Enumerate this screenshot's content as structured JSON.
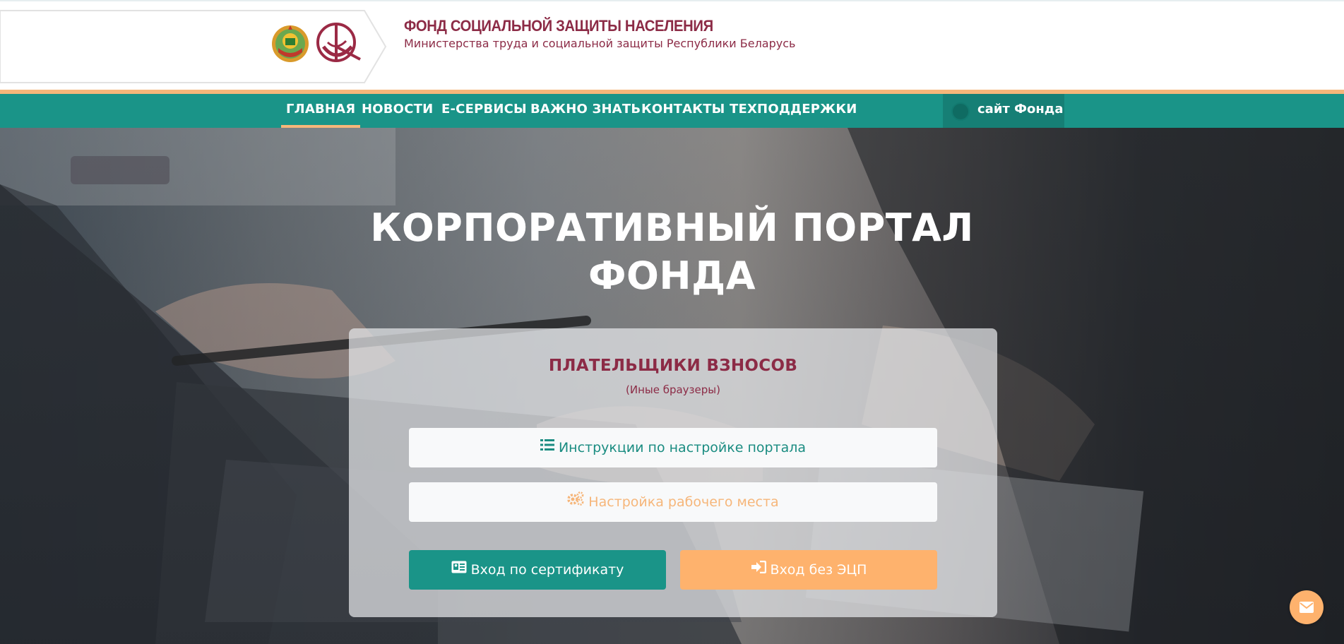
{
  "header": {
    "org_title": "ФОНД СОЦИАЛЬНОЙ ЗАЩИТЫ НАСЕЛЕНИЯ",
    "org_subtitle": "Министерства труда и социальной защиты Республики Беларусь"
  },
  "nav": {
    "items": [
      {
        "label": "ГЛАВНАЯ",
        "active": true
      },
      {
        "label": "НОВОСТИ",
        "active": false
      },
      {
        "label": "Е-СЕРВИСЫ",
        "active": false
      },
      {
        "label": "ВАЖНО ЗНАТЬ",
        "active": false
      },
      {
        "label": "КОНТАКТЫ ТЕХПОДДЕРЖКИ",
        "active": false
      }
    ],
    "site_link": "сайт Фонда"
  },
  "hero": {
    "title_line1": "КОРПОРАТИВНЫЙ ПОРТАЛ",
    "title_line2": "ФОНДА"
  },
  "panel": {
    "title": "ПЛАТЕЛЬЩИКИ ВЗНОСОВ",
    "subtitle": "(Иные браузеры)",
    "instructions_label": "Инструкции по настройке портала",
    "setup_label": "Настройка рабочего места",
    "cert_login_label": "Вход по сертификату",
    "noecp_login_label": "Вход без ЭЦП"
  },
  "colors": {
    "brand_teal": "#1a9488",
    "brand_orange": "#feb26d",
    "brand_maroon": "#8c2b46"
  },
  "icons": [
    "state-emblem-icon",
    "fund-logo-icon",
    "site-globe-icon",
    "list-icon",
    "gears-icon",
    "id-card-icon",
    "sign-in-icon",
    "envelope-icon"
  ]
}
